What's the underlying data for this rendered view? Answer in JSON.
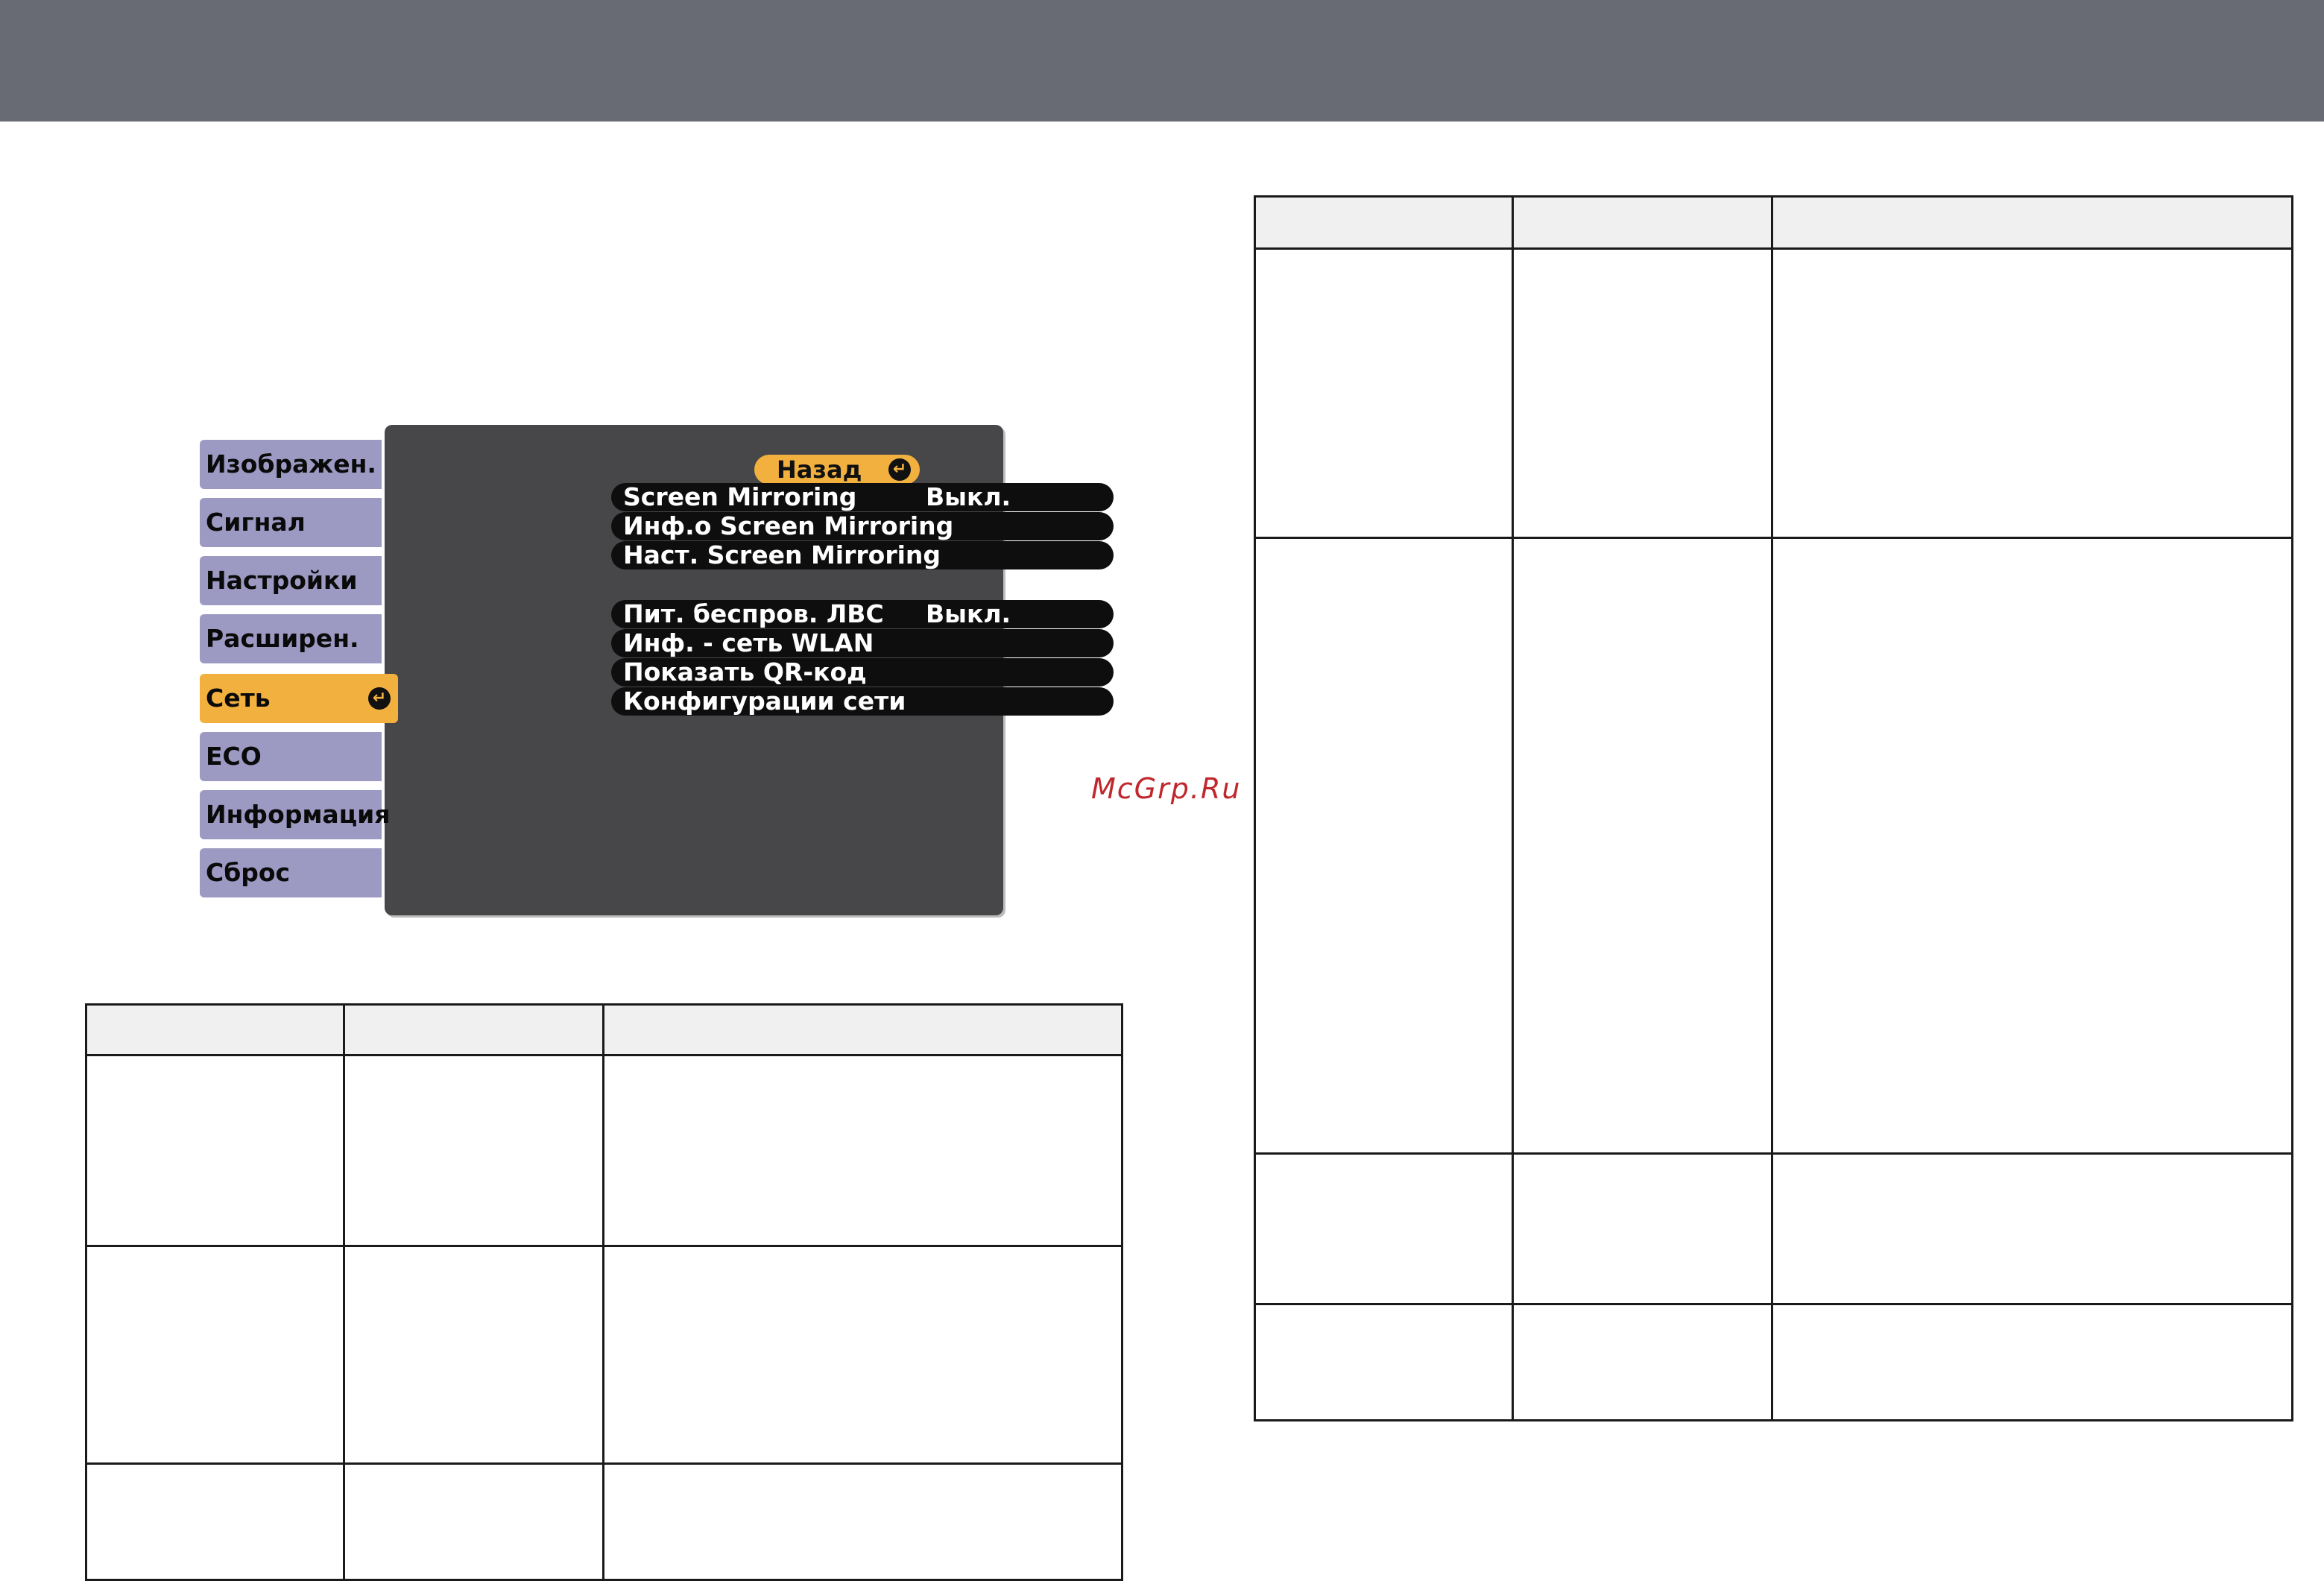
{
  "osd_menu": {
    "sidebar": [
      {
        "label": "Изображен.",
        "active": false
      },
      {
        "label": "Сигнал",
        "active": false
      },
      {
        "label": "Настройки",
        "active": false
      },
      {
        "label": "Расширен.",
        "active": false
      },
      {
        "label": "Сеть",
        "active": true
      },
      {
        "label": "ECO",
        "active": false
      },
      {
        "label": "Информация",
        "active": false
      },
      {
        "label": "Сброс",
        "active": false
      }
    ],
    "back_label": "Назад",
    "enter_icon_glyph": "↵",
    "rows": [
      {
        "label": "Screen Mirroring",
        "value": "Выкл."
      },
      {
        "label": "Инф.о Screen Mirroring",
        "value": ""
      },
      {
        "label": "Наст. Screen Mirroring",
        "value": ""
      },
      {
        "label": "Пит. беспров. ЛВС",
        "value": "Выкл."
      },
      {
        "label": "Инф. - сеть WLAN",
        "value": ""
      },
      {
        "label": "Показать QR-код",
        "value": ""
      },
      {
        "label": "Конфигурации сети",
        "value": ""
      }
    ],
    "colors": {
      "sidebar": "#9c99c2",
      "active": "#f2b13f",
      "panel": "#474749",
      "row": "#0e0e0e"
    }
  },
  "watermark": "McGrp.Ru",
  "colors": {
    "topbar": "#686b74",
    "watermark": "#c0272d"
  }
}
